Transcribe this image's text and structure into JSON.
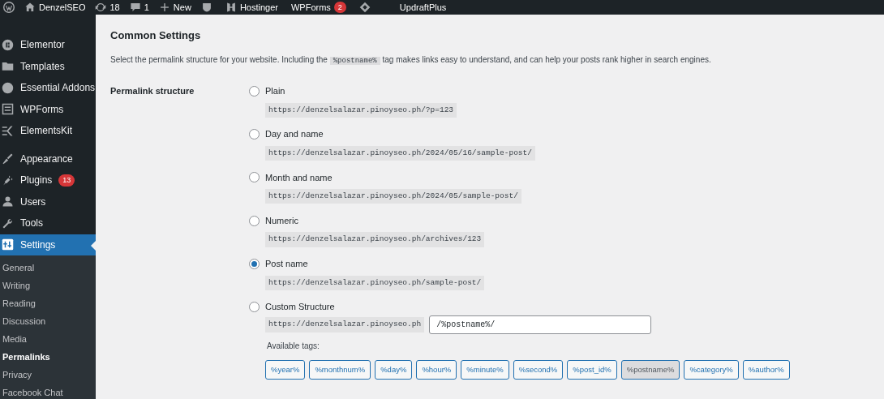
{
  "admin_bar": {
    "site": "DenzelSEO",
    "updates": "18",
    "comments": "1",
    "new": "New",
    "items": [
      {
        "label": "Hostinger",
        "kind": "hostinger"
      },
      {
        "label": "WPForms",
        "kind": "badge",
        "badge": "2"
      },
      {
        "label": "UpdraftPlus",
        "kind": "diamond"
      }
    ]
  },
  "sidebar": {
    "items": [
      {
        "label": "Elementor",
        "kind": "elementor",
        "selected": false
      },
      {
        "label": "Templates",
        "kind": "folder",
        "selected": false
      },
      {
        "label": "Essential Addons",
        "kind": "ea",
        "selected": false
      },
      {
        "label": "WPForms",
        "kind": "form",
        "selected": false
      },
      {
        "label": "ElementsKit",
        "kind": "ek",
        "selected": false
      },
      {
        "label": "Appearance",
        "kind": "brush",
        "selected": false
      },
      {
        "label": "Plugins",
        "kind": "plug",
        "selected": false,
        "badge": "13"
      },
      {
        "label": "Users",
        "kind": "user",
        "selected": false
      },
      {
        "label": "Tools",
        "kind": "wrench",
        "selected": false
      },
      {
        "label": "Settings",
        "kind": "settings",
        "selected": true
      }
    ],
    "submenu": [
      {
        "label": "General",
        "selected": false
      },
      {
        "label": "Writing",
        "selected": false
      },
      {
        "label": "Reading",
        "selected": false
      },
      {
        "label": "Discussion",
        "selected": false
      },
      {
        "label": "Media",
        "selected": false
      },
      {
        "label": "Permalinks",
        "selected": true
      },
      {
        "label": "Privacy",
        "selected": false
      },
      {
        "label": "Facebook Chat",
        "selected": false
      }
    ]
  },
  "section_title": "Common Settings",
  "description": {
    "before": "Select the permalink structure for your website. Including the",
    "code": "%postname%",
    "after": "tag makes links easy to understand, and can help your posts rank higher in search engines."
  },
  "field_label": "Permalink structure",
  "options": [
    {
      "label": "Plain",
      "example": "https://denzelsalazar.pinoyseo.ph/?p=123",
      "selected": false
    },
    {
      "label": "Day and name",
      "example": "https://denzelsalazar.pinoyseo.ph/2024/05/16/sample-post/",
      "selected": false
    },
    {
      "label": "Month and name",
      "example": "https://denzelsalazar.pinoyseo.ph/2024/05/sample-post/",
      "selected": false
    },
    {
      "label": "Numeric",
      "example": "https://denzelsalazar.pinoyseo.ph/archives/123",
      "selected": false
    },
    {
      "label": "Post name",
      "example": "https://denzelsalazar.pinoyseo.ph/sample-post/",
      "selected": true
    },
    {
      "label": "Custom Structure",
      "prefix": "https://denzelsalazar.pinoyseo.ph",
      "value": "/%postname%/",
      "selected": false
    }
  ],
  "available_tags_label": "Available tags:",
  "tags": [
    {
      "label": "%year%",
      "selected": false
    },
    {
      "label": "%monthnum%",
      "selected": false
    },
    {
      "label": "%day%",
      "selected": false
    },
    {
      "label": "%hour%",
      "selected": false
    },
    {
      "label": "%minute%",
      "selected": false
    },
    {
      "label": "%second%",
      "selected": false
    },
    {
      "label": "%post_id%",
      "selected": false
    },
    {
      "label": "%postname%",
      "selected": true
    },
    {
      "label": "%category%",
      "selected": false
    },
    {
      "label": "%author%",
      "selected": false
    }
  ]
}
